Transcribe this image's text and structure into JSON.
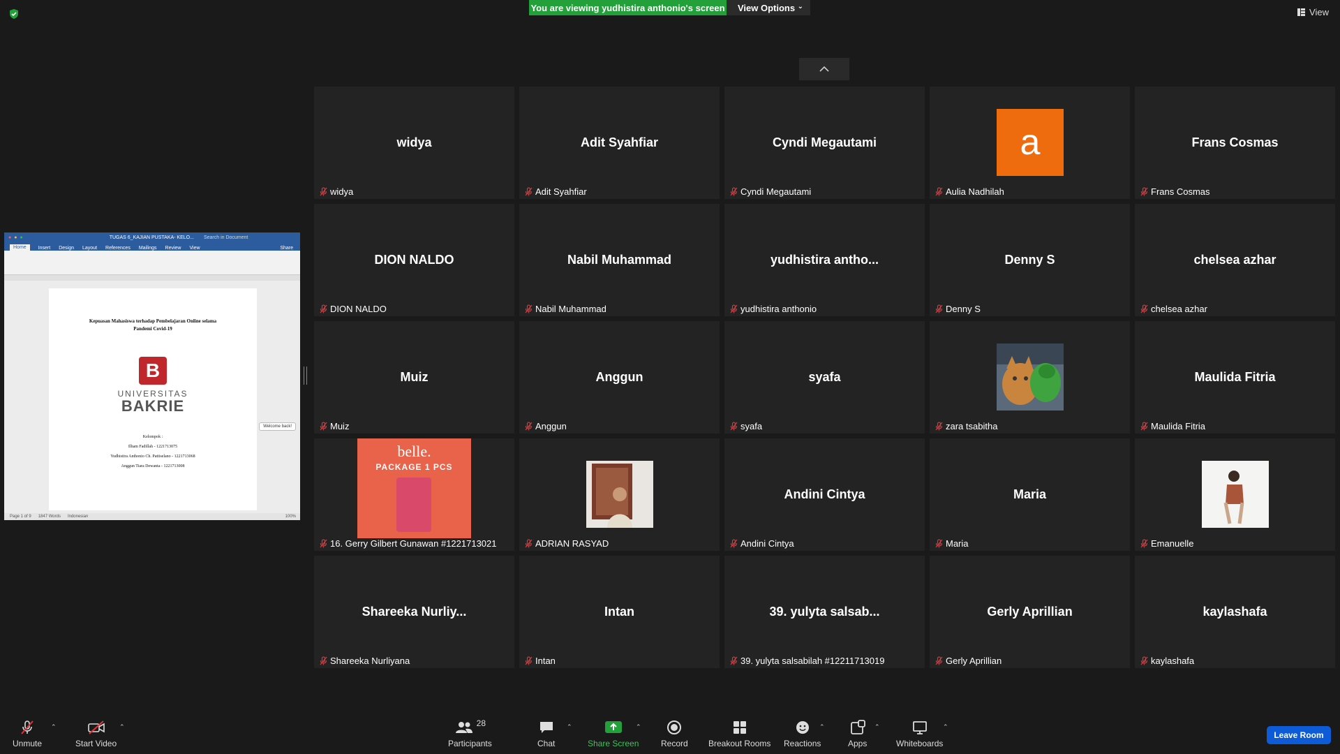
{
  "banner": {
    "text": "You are viewing yudhistira anthonio's screen",
    "view_options": "View Options"
  },
  "view_button": "View",
  "shared_doc": {
    "titlebar": "TUGAS 6_KAJIAN PUSTAKA- KELO...",
    "search_placeholder": "Search in Document",
    "tabs": [
      "Home",
      "Insert",
      "Design",
      "Layout",
      "References",
      "Mailings",
      "Review",
      "View"
    ],
    "share": "Share",
    "title_line1": "Kepuasan Mahasiswa terhadap Pembelajaran Online selama",
    "title_line2": "Pandemi Covid-19",
    "uni_line1": "UNIVERSITAS",
    "uni_line2": "BAKRIE",
    "kelompok": "Kelompok :",
    "members": [
      "Ilham Fadillah - 1221713075",
      "Yudhistira Anthonio Ch. Pattiselano - 1221713068",
      "Anggun Tiara Dewanta - 1221713008"
    ],
    "status": [
      "Page 1 of 9",
      "1847 Words",
      "Indonesian"
    ],
    "zoom": "100%",
    "welcome": "Welcome back!"
  },
  "participants": [
    {
      "big": "widya",
      "label": "widya",
      "kind": "text"
    },
    {
      "big": "Adit Syahfiar",
      "label": "Adit Syahfiar",
      "kind": "text"
    },
    {
      "big": "Cyndi Megautami",
      "label": "Cyndi Megautami",
      "kind": "text"
    },
    {
      "big": "a",
      "label": "Aulia Nadhilah",
      "kind": "avatar"
    },
    {
      "big": "Frans Cosmas",
      "label": "Frans Cosmas",
      "kind": "text"
    },
    {
      "big": "DION NALDO",
      "label": "DION NALDO",
      "kind": "text"
    },
    {
      "big": "Nabil Muhammad",
      "label": "Nabil Muhammad",
      "kind": "text"
    },
    {
      "big": "yudhistira  antho...",
      "label": "yudhistira anthonio",
      "kind": "text"
    },
    {
      "big": "Denny S",
      "label": "Denny S",
      "kind": "text"
    },
    {
      "big": "chelsea azhar",
      "label": "chelsea azhar",
      "kind": "text"
    },
    {
      "big": "Muiz",
      "label": "Muiz",
      "kind": "text"
    },
    {
      "big": "Anggun",
      "label": "Anggun",
      "kind": "text"
    },
    {
      "big": "syafa",
      "label": "syafa",
      "kind": "text"
    },
    {
      "big": "",
      "label": "zara tsabitha",
      "kind": "photo-cat"
    },
    {
      "big": "Maulida Fitria",
      "label": "Maulida Fitria",
      "kind": "text"
    },
    {
      "big": "",
      "label": "16. Gerry Gilbert Gunawan #1221713021",
      "kind": "photo-belle",
      "belle_brand": "belle.",
      "belle_package": "PACKAGE 1 PCS"
    },
    {
      "big": "",
      "label": "ADRIAN RASYAD",
      "kind": "photo-person"
    },
    {
      "big": "Andini Cintya",
      "label": "Andini Cintya",
      "kind": "text"
    },
    {
      "big": "Maria",
      "label": "Maria",
      "kind": "text"
    },
    {
      "big": "",
      "label": "Emanuelle",
      "kind": "photo-woman"
    },
    {
      "big": "Shareeka  Nurliy...",
      "label": "Shareeka Nurliyana",
      "kind": "text"
    },
    {
      "big": "Intan",
      "label": "Intan",
      "kind": "text"
    },
    {
      "big": "39. yulyta salsab...",
      "label": "39. yulyta salsabilah #12211713019",
      "kind": "text"
    },
    {
      "big": "Gerly Aprillian",
      "label": "Gerly Aprillian",
      "kind": "text"
    },
    {
      "big": "kaylashafa",
      "label": "kaylashafa",
      "kind": "text"
    }
  ],
  "toolbar": {
    "unmute": "Unmute",
    "start_video": "Start Video",
    "participants": "Participants",
    "participants_count": "28",
    "chat": "Chat",
    "share_screen": "Share Screen",
    "record": "Record",
    "breakout_rooms": "Breakout Rooms",
    "reactions": "Reactions",
    "apps": "Apps",
    "whiteboards": "Whiteboards",
    "leave_room": "Leave Room"
  },
  "colors": {
    "share_green": "#24a03a",
    "leave_blue": "#0e5bd8",
    "muted_red": "#e0353a",
    "avatar_orange": "#ef6c0e"
  }
}
